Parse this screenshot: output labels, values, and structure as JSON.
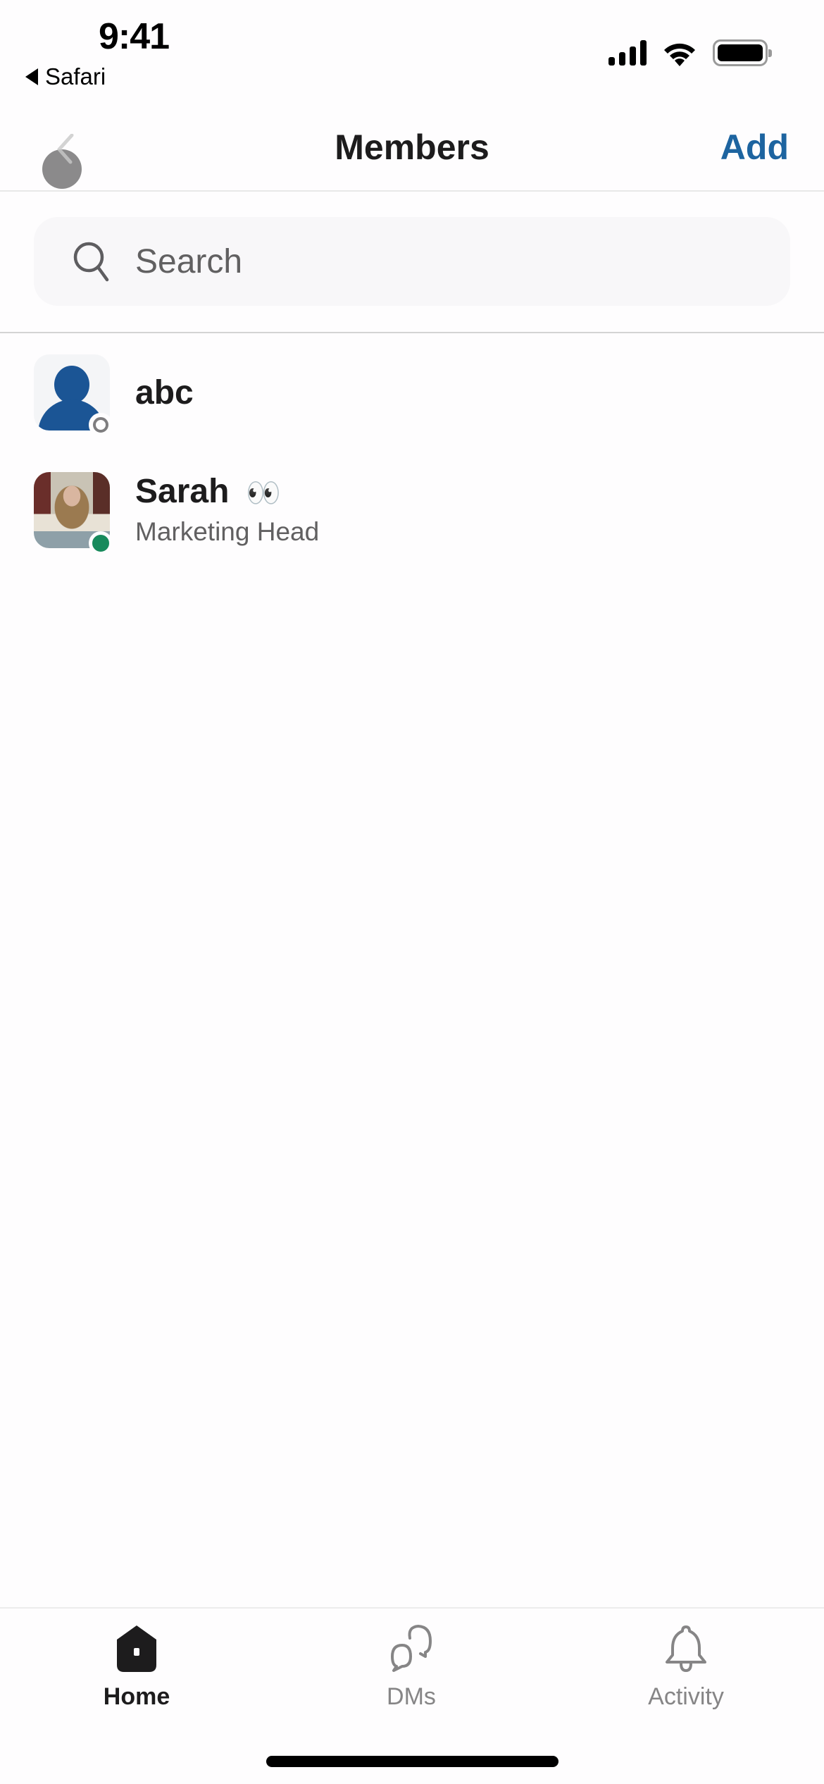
{
  "status_bar": {
    "time": "9:41",
    "back_app": "Safari",
    "icons": [
      "cellular-signal-icon",
      "wifi-icon",
      "battery-icon"
    ]
  },
  "header": {
    "title": "Members",
    "back_icon": "chevron-left-icon",
    "action_label": "Add",
    "accent_color": "#1d64a0"
  },
  "search": {
    "placeholder": "Search",
    "value": "",
    "icon": "search-icon"
  },
  "members": [
    {
      "name": "abc",
      "emoji": "",
      "title": "",
      "presence": "away",
      "avatar": "default-person-icon"
    },
    {
      "name": "Sarah",
      "emoji": "👀",
      "title": "Marketing Head",
      "presence": "active",
      "avatar": "profile-photo"
    }
  ],
  "presence_colors": {
    "active": "#188a5c",
    "away": "#7e7d7f"
  },
  "tabbar": {
    "tabs": [
      {
        "label": "Home",
        "icon": "home-icon",
        "active": true
      },
      {
        "label": "DMs",
        "icon": "dms-icon",
        "active": false
      },
      {
        "label": "Activity",
        "icon": "bell-icon",
        "active": false
      }
    ]
  }
}
